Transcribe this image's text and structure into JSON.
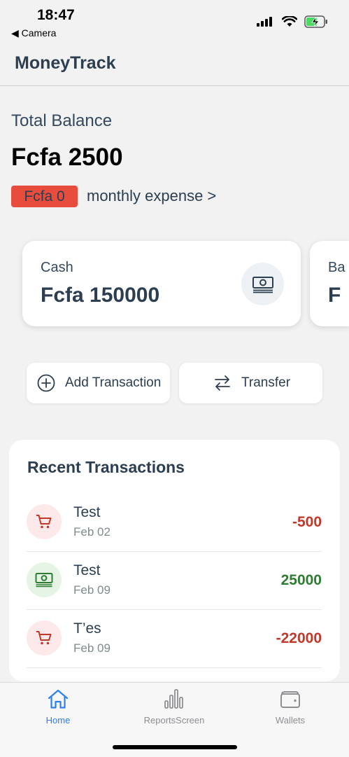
{
  "status": {
    "time": "18:47",
    "back_label": "◀ Camera"
  },
  "header": {
    "title": "MoneyTrack"
  },
  "balance": {
    "label": "Total Balance",
    "value": "Fcfa 2500",
    "expense_badge": "Fcfa 0",
    "expense_link": "monthly expense >"
  },
  "wallets": [
    {
      "name": "Cash",
      "amount": "Fcfa 150000",
      "icon": "cash-icon"
    },
    {
      "name": "Ba",
      "amount": "F",
      "icon": "bank-icon"
    }
  ],
  "actions": {
    "add_label": "Add Transaction",
    "transfer_label": "Transfer"
  },
  "recent": {
    "title": "Recent Transactions",
    "transactions": [
      {
        "name": "Test",
        "date": "Feb 02",
        "amount": "-500",
        "type": "expense",
        "icon": "cart-icon"
      },
      {
        "name": "Test",
        "date": "Feb 09",
        "amount": "25000",
        "type": "income",
        "icon": "cash-icon"
      },
      {
        "name": "T’es",
        "date": "Feb 09",
        "amount": "-22000",
        "type": "expense",
        "icon": "cart-icon"
      }
    ]
  },
  "tabs": [
    {
      "label": "Home",
      "icon": "home-icon",
      "active": true
    },
    {
      "label": "ReportsScreen",
      "icon": "bar-chart-icon",
      "active": false
    },
    {
      "label": "Wallets",
      "icon": "wallet-icon",
      "active": false
    }
  ],
  "colors": {
    "accent": "#2f80ed",
    "expense_badge": "#e74c3c",
    "expense_text": "#c0392b",
    "income_text": "#2e7d32",
    "text_primary": "#2c3e50"
  }
}
